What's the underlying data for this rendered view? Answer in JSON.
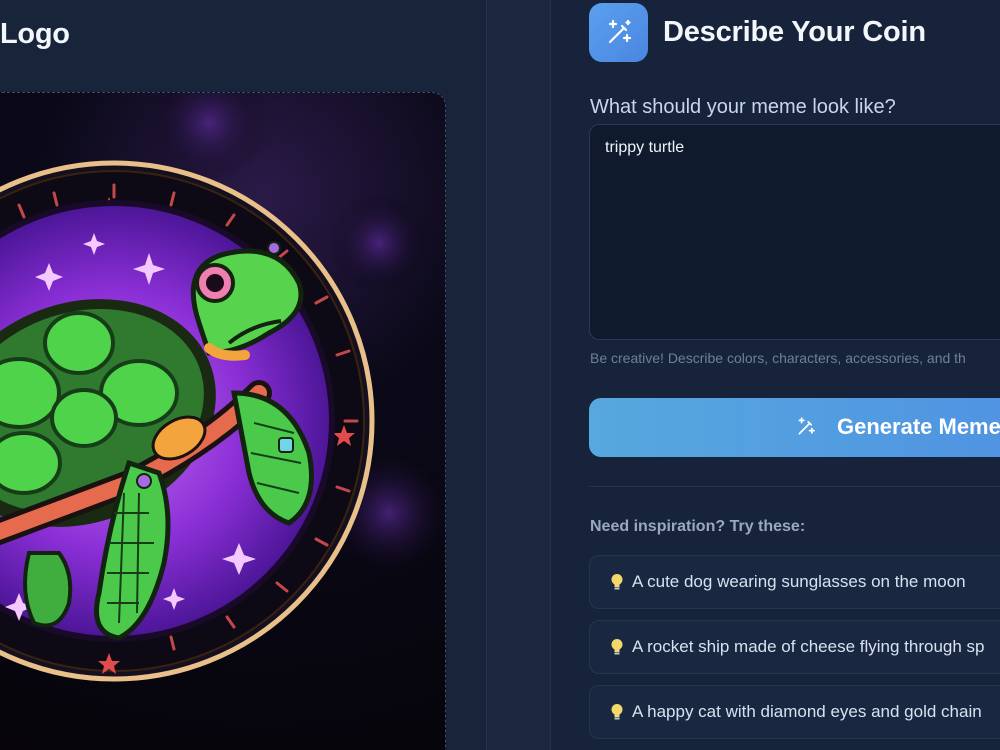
{
  "left": {
    "title": "Logo"
  },
  "right": {
    "title": "Describe Your Coin",
    "prompt_label": "What should your meme look like?",
    "prompt_value": "trippy turtle",
    "hint": "Be creative! Describe colors, characters, accessories, and th",
    "generate_label": "Generate Meme",
    "inspiration_label": "Need inspiration? Try these:",
    "suggestions": [
      "A cute dog wearing sunglasses on the moon",
      "A rocket ship made of cheese flying through sp",
      "A happy cat with diamond eyes and gold chain"
    ]
  },
  "icons": {
    "wand": "magic-wand-icon",
    "bulb": "lightbulb-icon"
  },
  "colors": {
    "accent": "#4f93e2",
    "background": "#17233a",
    "panel": "#18243a"
  }
}
